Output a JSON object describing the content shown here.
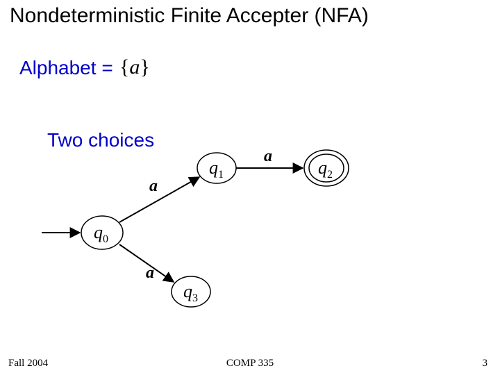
{
  "title": "Nondeterministic Finite Accepter (NFA)",
  "alphabet_label": "Alphabet =",
  "alphabet_value_open": "{",
  "alphabet_value_sym": "a",
  "alphabet_value_close": "}",
  "two_choices": "Two choices",
  "states": {
    "q0": {
      "q": "q",
      "sub": "0"
    },
    "q1": {
      "q": "q",
      "sub": "1"
    },
    "q2": {
      "q": "q",
      "sub": "2"
    },
    "q3": {
      "q": "q",
      "sub": "3"
    }
  },
  "edge_a": "a",
  "footer": {
    "left": "Fall 2004",
    "center": "COMP 335",
    "right": "3"
  }
}
